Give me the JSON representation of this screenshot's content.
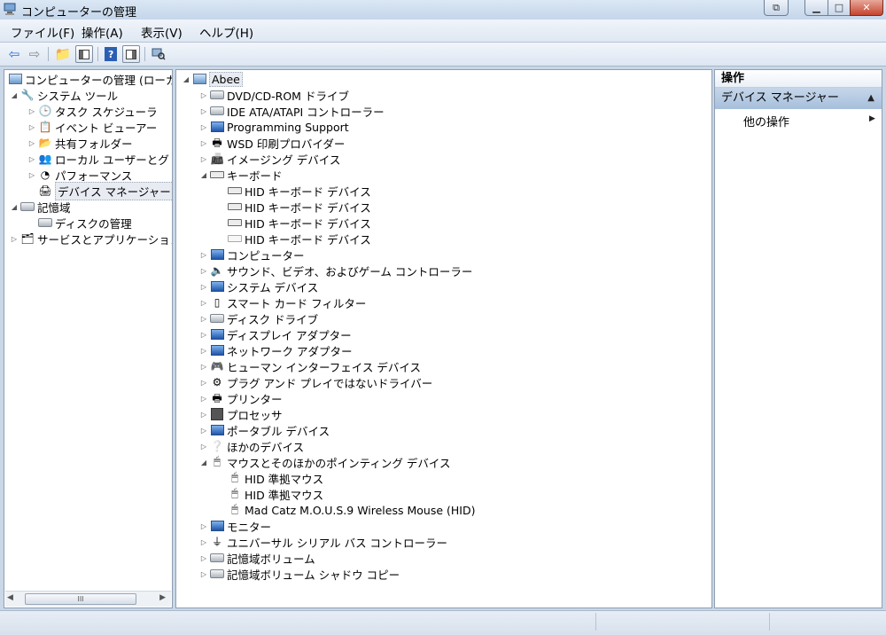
{
  "window": {
    "title": "コンピューターの管理"
  },
  "menubar": [
    "ファイル(F)",
    "操作(A)",
    "表示(V)",
    "ヘルプ(H)"
  ],
  "left_tree": {
    "root": "コンピューターの管理 (ローカル",
    "system_tools": "システム ツール",
    "task_scheduler": "タスク スケジューラ",
    "event_viewer": "イベント ビューアー",
    "shared_folders": "共有フォルダー",
    "local_users": "ローカル ユーザーとグ",
    "performance": "パフォーマンス",
    "device_manager": "デバイス マネージャー",
    "storage": "記憶域",
    "disk_management": "ディスクの管理",
    "services_apps": "サービスとアプリケーション"
  },
  "left_scroll": {
    "thumb_label": "III"
  },
  "device_tree": {
    "root": "Abee",
    "items": [
      "DVD/CD-ROM ドライブ",
      "IDE ATA/ATAPI コントローラー",
      "Programming Support",
      "WSD 印刷プロバイダー",
      "イメージング デバイス",
      "キーボード",
      "HID キーボード デバイス",
      "HID キーボード デバイス",
      "HID キーボード デバイス",
      "HID キーボード デバイス",
      "コンピューター",
      "サウンド、ビデオ、およびゲーム コントローラー",
      "システム デバイス",
      "スマート カード フィルター",
      "ディスク ドライブ",
      "ディスプレイ アダプター",
      "ネットワーク アダプター",
      "ヒューマン インターフェイス デバイス",
      "プラグ アンド プレイではないドライバー",
      "プリンター",
      "プロセッサ",
      "ポータブル デバイス",
      "ほかのデバイス",
      "マウスとそのほかのポインティング デバイス",
      "HID 準拠マウス",
      "HID 準拠マウス",
      "Mad Catz M.O.U.S.9 Wireless Mouse (HID)",
      "モニター",
      "ユニバーサル シリアル バス コントローラー",
      "記憶域ボリューム",
      "記憶域ボリューム シャドウ コピー"
    ]
  },
  "actions": {
    "header": "操作",
    "section": "デバイス マネージャー",
    "item": "他の操作"
  }
}
